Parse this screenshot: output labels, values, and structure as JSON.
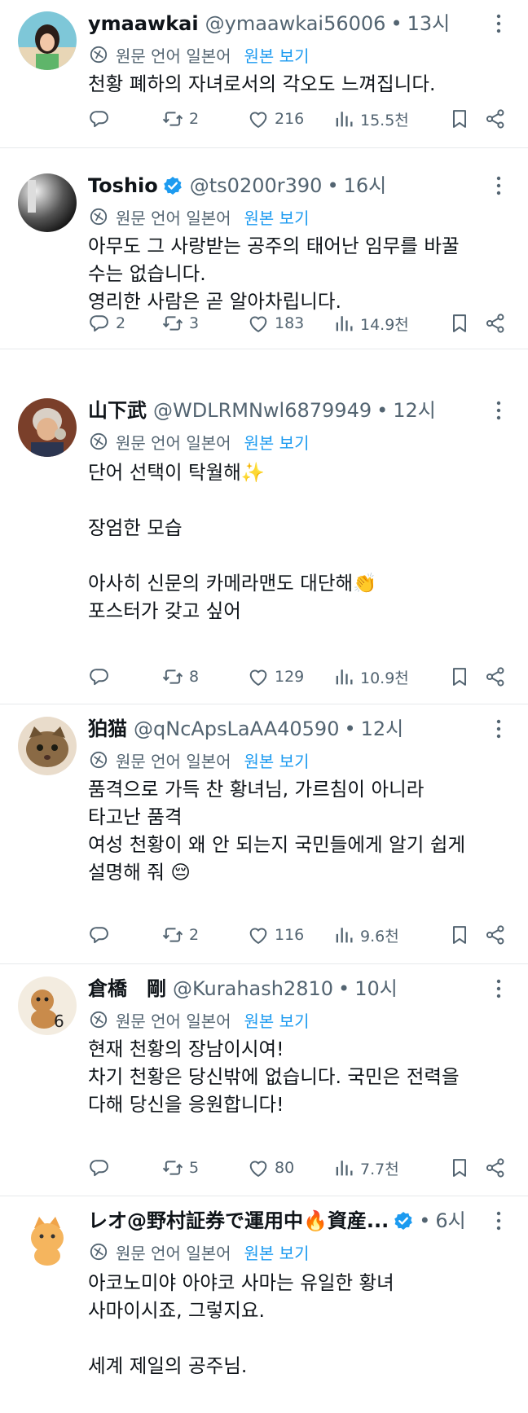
{
  "translate": {
    "source": "원문 언어 일본어",
    "original_link": "원본 보기"
  },
  "posts": [
    {
      "name": "ymaawkai",
      "handle": "@ymaawkai56006",
      "sep": "•",
      "time": "13시",
      "verified": false,
      "text": "천황 폐하의 자녀로서의 각오도 느껴집니다.",
      "reply": "",
      "retweet": "2",
      "like": "216",
      "views": "15.5천"
    },
    {
      "name": "Toshio",
      "handle": "@ts0200r390",
      "sep": "•",
      "time": "16시",
      "verified": true,
      "text": "아무도 그 사랑받는 공주의 태어난 임무를 바꿀\n수는 없습니다.\n영리한 사람은 곧 알아차립니다.",
      "reply": "2",
      "retweet": "3",
      "like": "183",
      "views": "14.9천"
    },
    {
      "name": "山下武",
      "handle": "@WDLRMNwl6879949",
      "sep": "•",
      "time": "12시",
      "verified": false,
      "text": "단어 선택이 탁월해✨\n\n장엄한 모습\n\n아사히 신문의 카메라맨도 대단해👏\n포스터가 갖고 싶어",
      "reply": "",
      "retweet": "8",
      "like": "129",
      "views": "10.9천"
    },
    {
      "name": "狛猫",
      "handle": "@qNcApsLaAA40590",
      "sep": "•",
      "time": "12시",
      "verified": false,
      "text": "품격으로 가득 찬 황녀님, 가르침이 아니라\n타고난 품격\n여성 천황이 왜 안 되는지 국민들에게 알기 쉽게\n설명해 줘 😔",
      "reply": "",
      "retweet": "2",
      "like": "116",
      "views": "9.6천"
    },
    {
      "name": "倉橋　剛",
      "handle": "@Kurahash2810",
      "sep": "•",
      "time": "10시",
      "verified": false,
      "text": "현재 천황의 장남이시여!\n차기 천황은 당신밖에 없습니다. 국민은 전력을\n다해 당신을 응원합니다!",
      "reply": "",
      "retweet": "5",
      "like": "80",
      "views": "7.7천"
    },
    {
      "name": "レオ@野村証券で運用中🔥資産...",
      "handle": "",
      "sep": "•",
      "time": "6시",
      "verified": true,
      "text": "아코노미야 아야코 사마는 유일한 황녀\n사마이시죠, 그렇지요.\n\n세계 제일의 공주님.",
      "reply": "",
      "retweet": "",
      "like": "",
      "views": ""
    }
  ],
  "colors": {
    "text": "#0f1419",
    "muted": "#536471",
    "link": "#1d9bf0",
    "verified": "#1d9bf0",
    "divider": "#e6e9eb"
  },
  "icons": [
    "translate-icon",
    "reply-icon",
    "retweet-icon",
    "like-icon",
    "views-icon",
    "bookmark-icon",
    "share-icon",
    "more-icon",
    "verified-badge-icon"
  ]
}
